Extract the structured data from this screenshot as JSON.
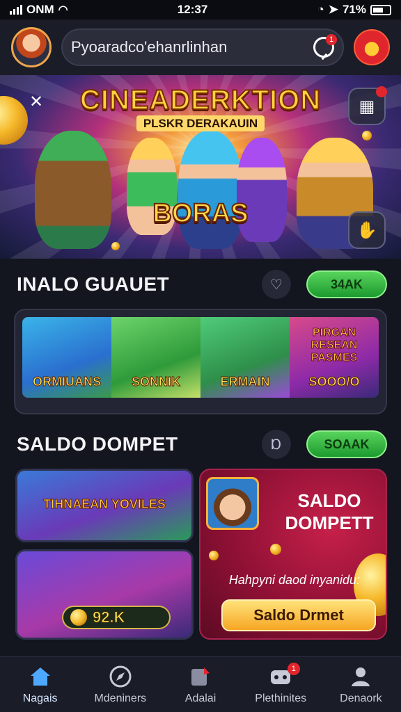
{
  "status_bar": {
    "carrier": "ONM",
    "time": "12:37",
    "battery": "71%"
  },
  "header": {
    "search_text": "Pyoaradco'ehanrlinhan",
    "search_badge": "1"
  },
  "hero": {
    "title": "CINEADERKTION",
    "subtitle": "PLSKR DERAKAUIN",
    "badge": "BORAS"
  },
  "section1": {
    "title": "INALO GUAUET",
    "button": "34AK",
    "games": [
      {
        "label": "ORMIUANS"
      },
      {
        "label": "SONNIK"
      },
      {
        "label": "ERMAIN"
      },
      {
        "label": "SOOO/O",
        "top_label": "PIRGAN RESEAN PASMES"
      }
    ]
  },
  "section2": {
    "title": "SALDO DOMPET",
    "button": "SOAAK",
    "card_top_label": "TIHNAEAN YOVILES",
    "balance": "92.K",
    "promo": {
      "title": "SALDO DOMPETT",
      "text": "Hahpyni daod inyanidu:",
      "button": "Saldo Drmet"
    }
  },
  "bottom_nav": [
    {
      "label": "Nagais",
      "icon": "home-icon",
      "active": true
    },
    {
      "label": "Mdeniners",
      "icon": "compass-icon"
    },
    {
      "label": "Adalai",
      "icon": "cards-icon"
    },
    {
      "label": "Plethinites",
      "icon": "controller-icon",
      "badge": "1"
    },
    {
      "label": "Denaork",
      "icon": "profile-icon"
    }
  ],
  "colors": {
    "accent_green": "#3fc44a",
    "gold": "#ffd23f",
    "promo_red": "#a01640",
    "bg": "#13151f"
  }
}
